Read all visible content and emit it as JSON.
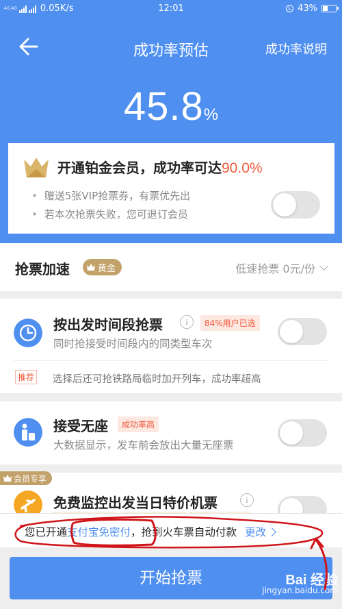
{
  "status_bar": {
    "network": "4G 4G",
    "speed": "0.05K/s",
    "time": "12:01",
    "battery": "43%",
    "battery_level": 0.43
  },
  "nav": {
    "title": "成功率预估",
    "help": "成功率说明",
    "back_icon": "arrow-left-icon"
  },
  "rate": {
    "value": "45.8",
    "unit": "%"
  },
  "vip": {
    "title": "开通铂金会员，成功率可达",
    "rate": "90.0%",
    "bullets": [
      "赠送5张VIP抢票券，有票优先出",
      "若本次抢票失败，您可退订会员"
    ],
    "toggle_on": false
  },
  "speed": {
    "label": "抢票加速",
    "badge": "黄金",
    "value": "低速抢票 0元/份"
  },
  "options": [
    {
      "title": "按出发时间段抢票",
      "tag": "84%用户已选",
      "desc": "同时抢接受时间段内的同类型车次",
      "icon": "clock-icon",
      "toggle_on": false,
      "recommend_badge": "推荐",
      "recommend_text": "选择后还可抢铁路局临时加开列车，成功率超高"
    },
    {
      "title": "接受无座",
      "tag": "成功率高",
      "desc": "大数据显示，发车前会放出大量无座票",
      "icon": "standing-person-icon",
      "toggle_on": false
    },
    {
      "member_tag": "会员专享",
      "title": "免费监控出发当日特价机票",
      "icon": "airplane-icon",
      "toggle_on": false
    }
  ],
  "payment": {
    "prefix": "您已开通",
    "link": "支付宝免密付",
    "suffix": "，抢到火车票自动付款",
    "change": "更改"
  },
  "start_button": "开始抢票",
  "watermark": {
    "brand": "Bai 经验",
    "url": "jingyan.baidu.com"
  },
  "colors": {
    "primary": "#4f8ff0",
    "gold": "#c2a26a",
    "accent_red": "#ee5a3c",
    "annotation": "#d0151a"
  }
}
